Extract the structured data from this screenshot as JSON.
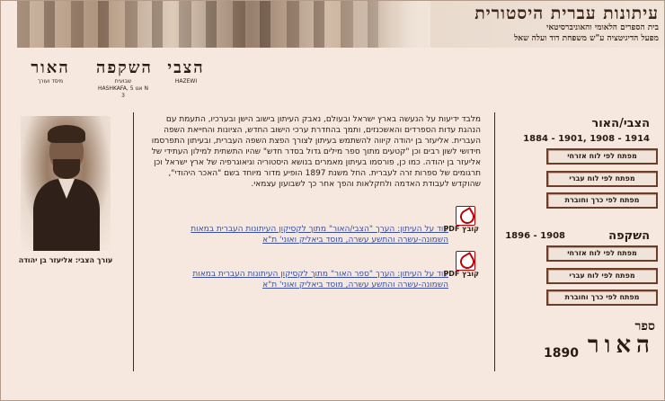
{
  "banner": {
    "title": "עיתונות עברית היסטורית",
    "line1": "בית הספרים הלאומי והאוניברסיטאי",
    "line2": "מפעל הדיגיטציה ע\"ש משפחת דוד ועלה שאל"
  },
  "logos": {
    "haor": {
      "name": "האור",
      "small": "מיסד ועורך"
    },
    "hashkafa": {
      "name": "השקפה",
      "sub": "שבועית",
      "small": "HASHKAFA, 5 אגו N 3"
    },
    "hazewi": {
      "name": "הצבי",
      "small": "HAZEWI"
    }
  },
  "portrait": {
    "caption": "עורך הצבי: אליעזר בן יהודה"
  },
  "main": {
    "paragraph": "מלבד ידיעות על הנעשה בארץ ישראל ובעולם, נאבק העיתון בישוב הישן ובערכיו, התעמת עם הנהגת עדות הספרדים והאשכנזים, ותמך בהחדרת ערכי הישוב החדש, הציונות והחייאת השפה העברית. אליעזר בן יהודה קיווה להשתמש בעיתון לצורך הפצת השפה העברית, ובעיתון התפרסמו חידושי לשון רבים וכן \"קטעים מתוך ספר מילים גדול בסדר חדש\" שהיו התשתית למילון העתידי של אליעזר בן יהודה. כמו כן, פורסמו בעיתון מאמרים בנושא היסטוריה וגיאוגרפיה של ארץ ישראל וכן תרגומים של ספרות זרה לעברית. החל משנת 1897 הופיע מדור מיוחד בשם \"האכר היהודי\", שהוקדש לעבודת האדמה ולחקלאות והפך אחר כך לשבועון עצמאי."
  },
  "pdf_links": [
    {
      "label": "קובץ PDF",
      "text": "עוד על העיתון: הערך \"הצבי/האור\" מתוך לקסיקון העיתונות העברית במאות השמונה-עשרה והתשע עשרה, מוסד ביאליק ואוני' ת\"א"
    },
    {
      "label": "קובץ PDF",
      "text": "עוד על העיתון: הערך \"ספר האור\" מתוך לקסיקון העיתונות העברית במאות השמונה-עשרה והתשע עשרה, מוסד ביאליק ואוני' ת\"א"
    }
  ],
  "sidebar": {
    "section1": {
      "title": "הצבי/האור",
      "years": "1884 - 1901, 1908 - 1914",
      "buttons": [
        "מפתח לפי לוח אזרחי",
        "מפתח לפי לוח עברי",
        "מפתח לפי כרך וחוברת"
      ]
    },
    "section2": {
      "title": "השקפה",
      "years": "1896 - 1908",
      "buttons": [
        "מפתח לפי לוח אזרחי",
        "מפתח לפי לוח עברי",
        "מפתח לפי כרך וחוברת"
      ]
    },
    "sefer": {
      "word": "ספר",
      "name": "האור",
      "year": "1890"
    }
  }
}
